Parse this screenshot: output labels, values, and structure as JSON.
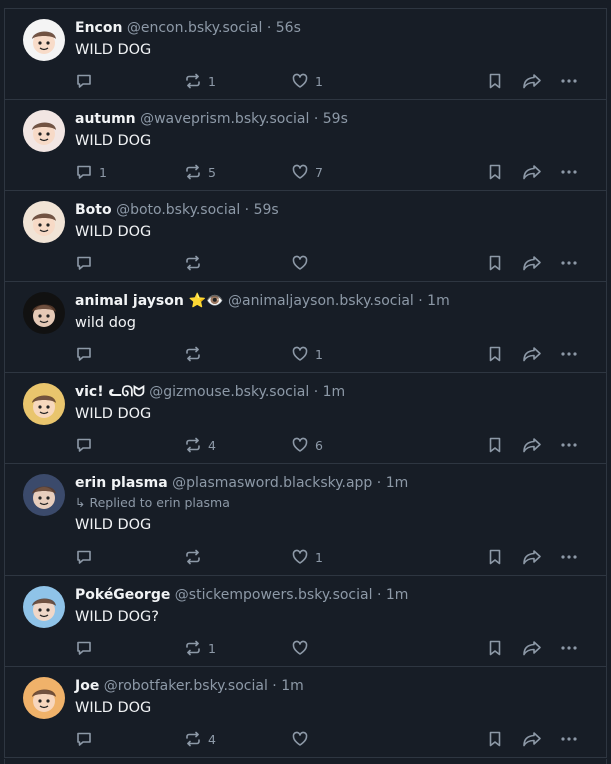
{
  "posts": [
    {
      "name": "Encon",
      "handle": "@encon.bsky.social",
      "sep": "·",
      "time": "56s",
      "text": "WILD DOG",
      "replies": "",
      "reposts": "1",
      "likes": "1",
      "avatar": "avatar-encon",
      "bg": "#f4f4f4"
    },
    {
      "name": "autumn",
      "handle": "@waveprism.bsky.social",
      "sep": "·",
      "time": "59s",
      "text": "WILD DOG",
      "replies": "1",
      "reposts": "5",
      "likes": "7",
      "avatar": "avatar-autumn",
      "bg": "#f2e6e3"
    },
    {
      "name": "Boto",
      "handle": "@boto.bsky.social",
      "sep": "·",
      "time": "59s",
      "text": "WILD DOG",
      "replies": "",
      "reposts": "",
      "likes": "",
      "avatar": "avatar-boto",
      "bg": "#f1e4d6"
    },
    {
      "name": "animal jayson ⭐👁️",
      "handle": "@animaljayson.bsky.social",
      "sep": "·",
      "time": "1m",
      "text": "wild dog",
      "replies": "",
      "reposts": "",
      "likes": "1",
      "avatar": "avatar-jayson",
      "bg": "#111111"
    },
    {
      "name": "vic! ᓚᘏᗢ",
      "handle": "@gizmouse.bsky.social",
      "sep": "·",
      "time": "1m",
      "text": "WILD DOG",
      "replies": "",
      "reposts": "4",
      "likes": "6",
      "avatar": "avatar-vic",
      "bg": "#e9c56d"
    },
    {
      "name": "erin plasma",
      "handle": "@plasmasword.blacksky.app",
      "sep": "·",
      "time": "1m",
      "reply": "↳ Replied to erin plasma",
      "text": "WILD DOG",
      "replies": "",
      "reposts": "",
      "likes": "1",
      "avatar": "avatar-erin",
      "bg": "#3b4a6b"
    },
    {
      "name": "PokéGeorge",
      "handle": "@stickempowers.bsky.social",
      "sep": "·",
      "time": "1m",
      "text": "WILD DOG?",
      "replies": "",
      "reposts": "1",
      "likes": "",
      "avatar": "avatar-pokegeorge",
      "bg": "#8fc3e8"
    },
    {
      "name": "Joe",
      "handle": "@robotfaker.bsky.social",
      "sep": "·",
      "time": "1m",
      "text": "WILD DOG",
      "replies": "",
      "reposts": "4",
      "likes": "",
      "avatar": "avatar-joe",
      "bg": "#f0b26a"
    }
  ],
  "colors": {
    "background": "#171d26",
    "border": "#2e3641",
    "muted": "#8d99a7",
    "text": "#f1f3f5"
  }
}
